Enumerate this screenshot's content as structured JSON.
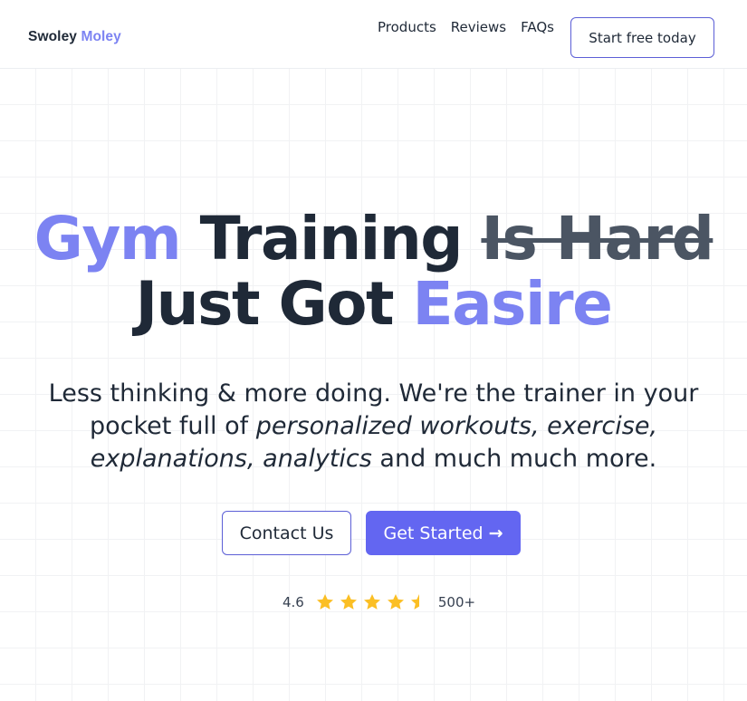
{
  "brand": {
    "name_part1": "Swoley",
    "name_part2": "Moley"
  },
  "nav": {
    "links": [
      "Products",
      "Reviews",
      "FAQs"
    ],
    "cta_label": "Start free today"
  },
  "hero": {
    "headline_accent1": "Gym",
    "headline_text1": "Training",
    "headline_strike": "Is Hard",
    "headline_text2": "Just Got",
    "headline_accent2": "Easire",
    "sub_part1": "Less thinking & more doing. We're the trainer in your pocket full of ",
    "sub_italic1": "personalized workouts, exercise, explanations, analytics",
    "sub_part2": " and much much more."
  },
  "buttons": {
    "contact_label": "Contact Us",
    "start_label": "Get Started",
    "start_icon": "arrow-right-icon"
  },
  "rating": {
    "score": "4.6",
    "stars_value": 4.5,
    "stars_max": 5,
    "count": "500+",
    "star_color": "#fbbf24"
  },
  "colors": {
    "accent": "#7c83f2",
    "primary_button": "#6366f1",
    "text": "#1f2937"
  }
}
